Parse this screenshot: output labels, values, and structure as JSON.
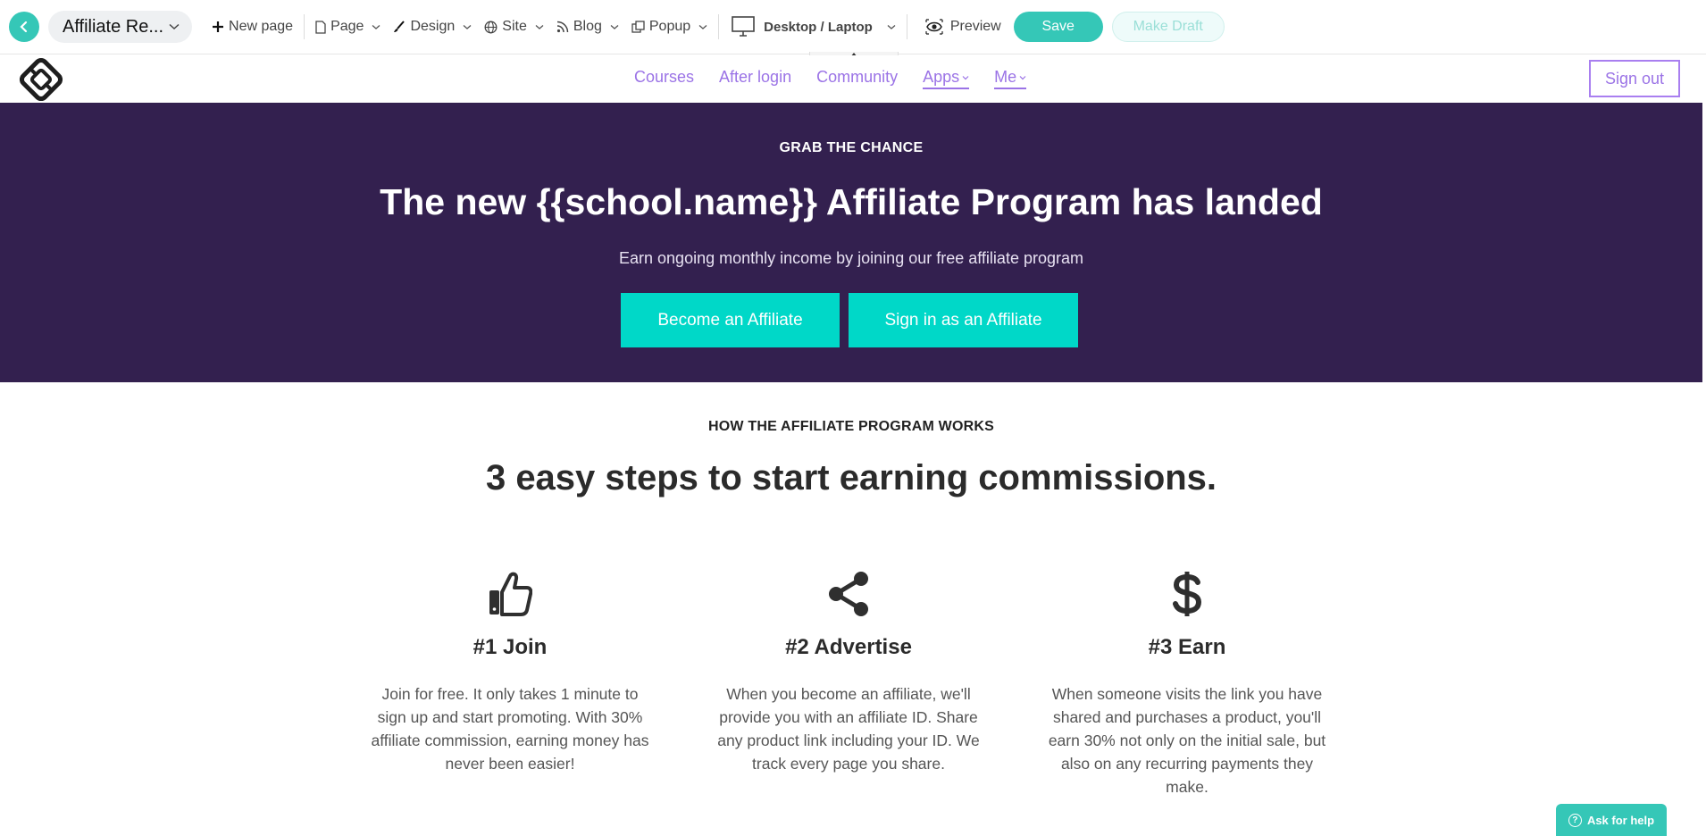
{
  "toolbar": {
    "page_name": "Affiliate Re...",
    "new_page": "New page",
    "page": "Page",
    "design": "Design",
    "site": "Site",
    "blog": "Blog",
    "popup": "Popup",
    "device": "Desktop / Laptop",
    "preview": "Preview",
    "save": "Save",
    "make_draft": "Make Draft"
  },
  "site_nav": {
    "items": [
      "Courses",
      "After login",
      "Community",
      "Apps",
      "Me"
    ],
    "sign_out": "Sign out"
  },
  "hero": {
    "eyebrow": "GRAB THE CHANCE",
    "title": "The new {{school.name}} Affiliate Program has landed",
    "subtitle": "Earn ongoing monthly income by joining our free affiliate program",
    "become_btn": "Become an Affiliate",
    "signin_btn": "Sign in as an Affiliate"
  },
  "how": {
    "eyebrow": "HOW THE AFFILIATE PROGRAM WORKS",
    "title": "3 easy steps to start earning commissions.",
    "steps": [
      {
        "icon": "thumbs-up-icon",
        "title": "#1 Join",
        "text": "Join for free. It only takes 1 minute to sign up and start promoting. With 30% affiliate commission, earning money has never been easier!"
      },
      {
        "icon": "share-icon",
        "title": "#2 Advertise",
        "text": "When you become an affiliate, we'll provide you with an affiliate ID. Share any product link including your ID. We track every page you share."
      },
      {
        "icon": "dollar-icon",
        "title": "#3 Earn",
        "text": "When someone visits the link you have shared and purchases a product, you'll earn 30% not only on the initial sale, but also on any recurring payments they make."
      }
    ]
  },
  "help": {
    "label": "Ask for help"
  },
  "colors": {
    "accent": "#35c7b7",
    "hero_bg": "#33204f",
    "hero_button": "#00d8c8",
    "nav_link": "#9b73e6"
  }
}
